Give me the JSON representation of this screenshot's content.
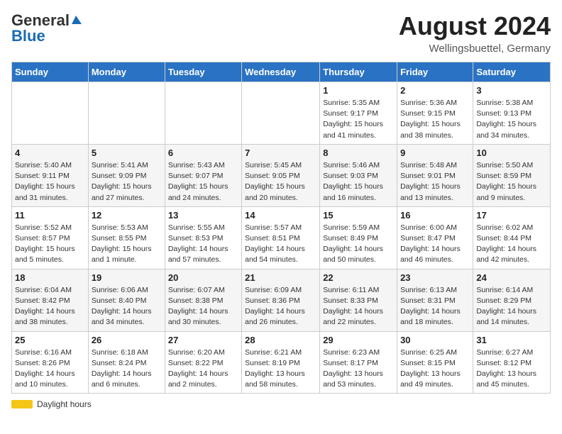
{
  "header": {
    "logo_general": "General",
    "logo_blue": "Blue",
    "month_year": "August 2024",
    "location": "Wellingsbuettel, Germany"
  },
  "days_of_week": [
    "Sunday",
    "Monday",
    "Tuesday",
    "Wednesday",
    "Thursday",
    "Friday",
    "Saturday"
  ],
  "weeks": [
    [
      {
        "day": "",
        "info": ""
      },
      {
        "day": "",
        "info": ""
      },
      {
        "day": "",
        "info": ""
      },
      {
        "day": "",
        "info": ""
      },
      {
        "day": "1",
        "info": "Sunrise: 5:35 AM\nSunset: 9:17 PM\nDaylight: 15 hours\nand 41 minutes."
      },
      {
        "day": "2",
        "info": "Sunrise: 5:36 AM\nSunset: 9:15 PM\nDaylight: 15 hours\nand 38 minutes."
      },
      {
        "day": "3",
        "info": "Sunrise: 5:38 AM\nSunset: 9:13 PM\nDaylight: 15 hours\nand 34 minutes."
      }
    ],
    [
      {
        "day": "4",
        "info": "Sunrise: 5:40 AM\nSunset: 9:11 PM\nDaylight: 15 hours\nand 31 minutes."
      },
      {
        "day": "5",
        "info": "Sunrise: 5:41 AM\nSunset: 9:09 PM\nDaylight: 15 hours\nand 27 minutes."
      },
      {
        "day": "6",
        "info": "Sunrise: 5:43 AM\nSunset: 9:07 PM\nDaylight: 15 hours\nand 24 minutes."
      },
      {
        "day": "7",
        "info": "Sunrise: 5:45 AM\nSunset: 9:05 PM\nDaylight: 15 hours\nand 20 minutes."
      },
      {
        "day": "8",
        "info": "Sunrise: 5:46 AM\nSunset: 9:03 PM\nDaylight: 15 hours\nand 16 minutes."
      },
      {
        "day": "9",
        "info": "Sunrise: 5:48 AM\nSunset: 9:01 PM\nDaylight: 15 hours\nand 13 minutes."
      },
      {
        "day": "10",
        "info": "Sunrise: 5:50 AM\nSunset: 8:59 PM\nDaylight: 15 hours\nand 9 minutes."
      }
    ],
    [
      {
        "day": "11",
        "info": "Sunrise: 5:52 AM\nSunset: 8:57 PM\nDaylight: 15 hours\nand 5 minutes."
      },
      {
        "day": "12",
        "info": "Sunrise: 5:53 AM\nSunset: 8:55 PM\nDaylight: 15 hours\nand 1 minute."
      },
      {
        "day": "13",
        "info": "Sunrise: 5:55 AM\nSunset: 8:53 PM\nDaylight: 14 hours\nand 57 minutes."
      },
      {
        "day": "14",
        "info": "Sunrise: 5:57 AM\nSunset: 8:51 PM\nDaylight: 14 hours\nand 54 minutes."
      },
      {
        "day": "15",
        "info": "Sunrise: 5:59 AM\nSunset: 8:49 PM\nDaylight: 14 hours\nand 50 minutes."
      },
      {
        "day": "16",
        "info": "Sunrise: 6:00 AM\nSunset: 8:47 PM\nDaylight: 14 hours\nand 46 minutes."
      },
      {
        "day": "17",
        "info": "Sunrise: 6:02 AM\nSunset: 8:44 PM\nDaylight: 14 hours\nand 42 minutes."
      }
    ],
    [
      {
        "day": "18",
        "info": "Sunrise: 6:04 AM\nSunset: 8:42 PM\nDaylight: 14 hours\nand 38 minutes."
      },
      {
        "day": "19",
        "info": "Sunrise: 6:06 AM\nSunset: 8:40 PM\nDaylight: 14 hours\nand 34 minutes."
      },
      {
        "day": "20",
        "info": "Sunrise: 6:07 AM\nSunset: 8:38 PM\nDaylight: 14 hours\nand 30 minutes."
      },
      {
        "day": "21",
        "info": "Sunrise: 6:09 AM\nSunset: 8:36 PM\nDaylight: 14 hours\nand 26 minutes."
      },
      {
        "day": "22",
        "info": "Sunrise: 6:11 AM\nSunset: 8:33 PM\nDaylight: 14 hours\nand 22 minutes."
      },
      {
        "day": "23",
        "info": "Sunrise: 6:13 AM\nSunset: 8:31 PM\nDaylight: 14 hours\nand 18 minutes."
      },
      {
        "day": "24",
        "info": "Sunrise: 6:14 AM\nSunset: 8:29 PM\nDaylight: 14 hours\nand 14 minutes."
      }
    ],
    [
      {
        "day": "25",
        "info": "Sunrise: 6:16 AM\nSunset: 8:26 PM\nDaylight: 14 hours\nand 10 minutes."
      },
      {
        "day": "26",
        "info": "Sunrise: 6:18 AM\nSunset: 8:24 PM\nDaylight: 14 hours\nand 6 minutes."
      },
      {
        "day": "27",
        "info": "Sunrise: 6:20 AM\nSunset: 8:22 PM\nDaylight: 14 hours\nand 2 minutes."
      },
      {
        "day": "28",
        "info": "Sunrise: 6:21 AM\nSunset: 8:19 PM\nDaylight: 13 hours\nand 58 minutes."
      },
      {
        "day": "29",
        "info": "Sunrise: 6:23 AM\nSunset: 8:17 PM\nDaylight: 13 hours\nand 53 minutes."
      },
      {
        "day": "30",
        "info": "Sunrise: 6:25 AM\nSunset: 8:15 PM\nDaylight: 13 hours\nand 49 minutes."
      },
      {
        "day": "31",
        "info": "Sunrise: 6:27 AM\nSunset: 8:12 PM\nDaylight: 13 hours\nand 45 minutes."
      }
    ]
  ],
  "legend": {
    "label": "Daylight hours"
  }
}
